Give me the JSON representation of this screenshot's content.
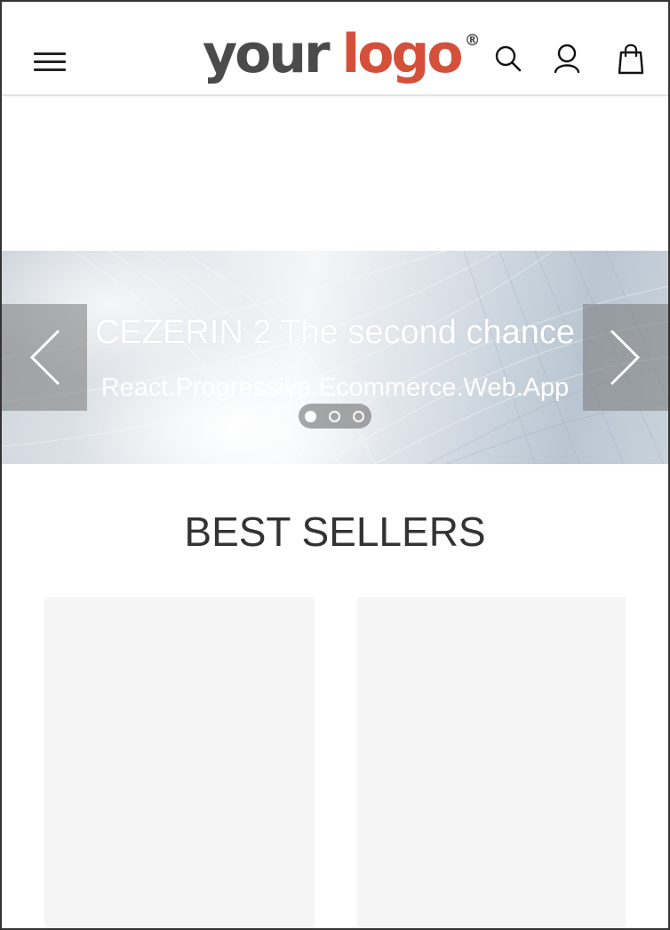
{
  "header": {
    "logo": {
      "word1": "your",
      "word2": "logo",
      "registered": "®",
      "colors": {
        "your": "#4b4b4b",
        "logo": "#d4503a"
      }
    },
    "icons": [
      "menu-icon",
      "search-icon",
      "account-icon",
      "cart-icon"
    ]
  },
  "slider": {
    "title": "CEZERIN 2 The second chance",
    "subtitle": "React.Progressive.Ecommerce.Web.App",
    "slide_count": 3,
    "active_index": 0,
    "icons": [
      "chevron-left-icon",
      "chevron-right-icon"
    ]
  },
  "best_sellers": {
    "title": "BEST SELLERS",
    "placeholder_color": "#f5f5f5"
  }
}
